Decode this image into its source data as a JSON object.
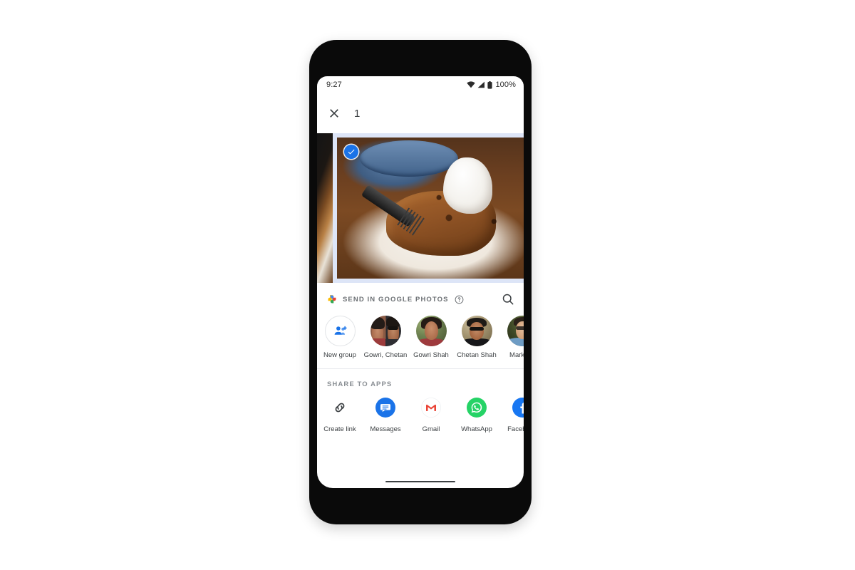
{
  "device": {
    "frame": "pixel-phone",
    "accent": "#1a73e8"
  },
  "status_bar": {
    "time": "9:27",
    "battery_percent": "100%",
    "icons": [
      "wifi-icon",
      "cell-signal-icon",
      "battery-icon"
    ]
  },
  "app_bar": {
    "close_icon": "close-icon",
    "selected_count": "1"
  },
  "photo_strip": {
    "items": [
      {
        "id": "photo-left",
        "selected": false,
        "visible": "partial"
      },
      {
        "id": "photo-selected",
        "selected": true,
        "visible": "full"
      },
      {
        "id": "photo-right",
        "selected": false,
        "visible": "partial"
      }
    ]
  },
  "send_section": {
    "brand_icon": "google-photos-icon",
    "label": "SEND IN GOOGLE PHOTOS",
    "help_icon": "help-circle-icon",
    "search_icon": "search-icon",
    "contacts": [
      {
        "name": "New group",
        "avatar": "person-add-icon"
      },
      {
        "name": "Gowri,\nChetan",
        "avatar": "avatar-gowri-chetan"
      },
      {
        "name": "Gowri Shah",
        "avatar": "avatar-gowri"
      },
      {
        "name": "Chetan Shah",
        "avatar": "avatar-chetan"
      },
      {
        "name": "Mark Ch",
        "avatar": "avatar-mark"
      }
    ]
  },
  "apps_section": {
    "label": "SHARE TO APPS",
    "apps": [
      {
        "name": "Create link",
        "icon": "link-icon",
        "color": "#3c4043"
      },
      {
        "name": "Messages",
        "icon": "messages-icon",
        "color": "#1a73e8"
      },
      {
        "name": "Gmail",
        "icon": "gmail-icon",
        "color": "#ea4335"
      },
      {
        "name": "WhatsApp",
        "icon": "whatsapp-icon",
        "color": "#25d366"
      },
      {
        "name": "Facebook",
        "icon": "facebook-icon",
        "color": "#1877f2"
      }
    ]
  },
  "nav": {
    "gesture_bar": "home-gesture-bar"
  }
}
